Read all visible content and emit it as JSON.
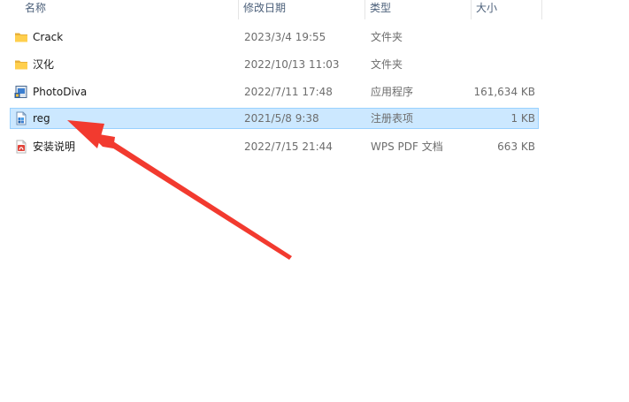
{
  "columns": {
    "name": "名称",
    "date": "修改日期",
    "type": "类型",
    "size": "大小"
  },
  "files": [
    {
      "name": "Crack",
      "date": "2023/3/4 19:55",
      "type": "文件夹",
      "size": "",
      "icon": "folder-icon",
      "selected": false
    },
    {
      "name": "汉化",
      "date": "2022/10/13 11:03",
      "type": "文件夹",
      "size": "",
      "icon": "folder-icon",
      "selected": false
    },
    {
      "name": "PhotoDiva",
      "date": "2022/7/11 17:48",
      "type": "应用程序",
      "size": "161,634 KB",
      "icon": "application-icon",
      "selected": false
    },
    {
      "name": "reg",
      "date": "2021/5/8 9:38",
      "type": "注册表项",
      "size": "1 KB",
      "icon": "registry-file-icon",
      "selected": true
    },
    {
      "name": "安装说明",
      "date": "2022/7/15 21:44",
      "type": "WPS PDF 文档",
      "size": "663 KB",
      "icon": "pdf-file-icon",
      "selected": false
    }
  ],
  "annotation": {
    "icon": "red-arrow",
    "color": "#f23a2f"
  }
}
